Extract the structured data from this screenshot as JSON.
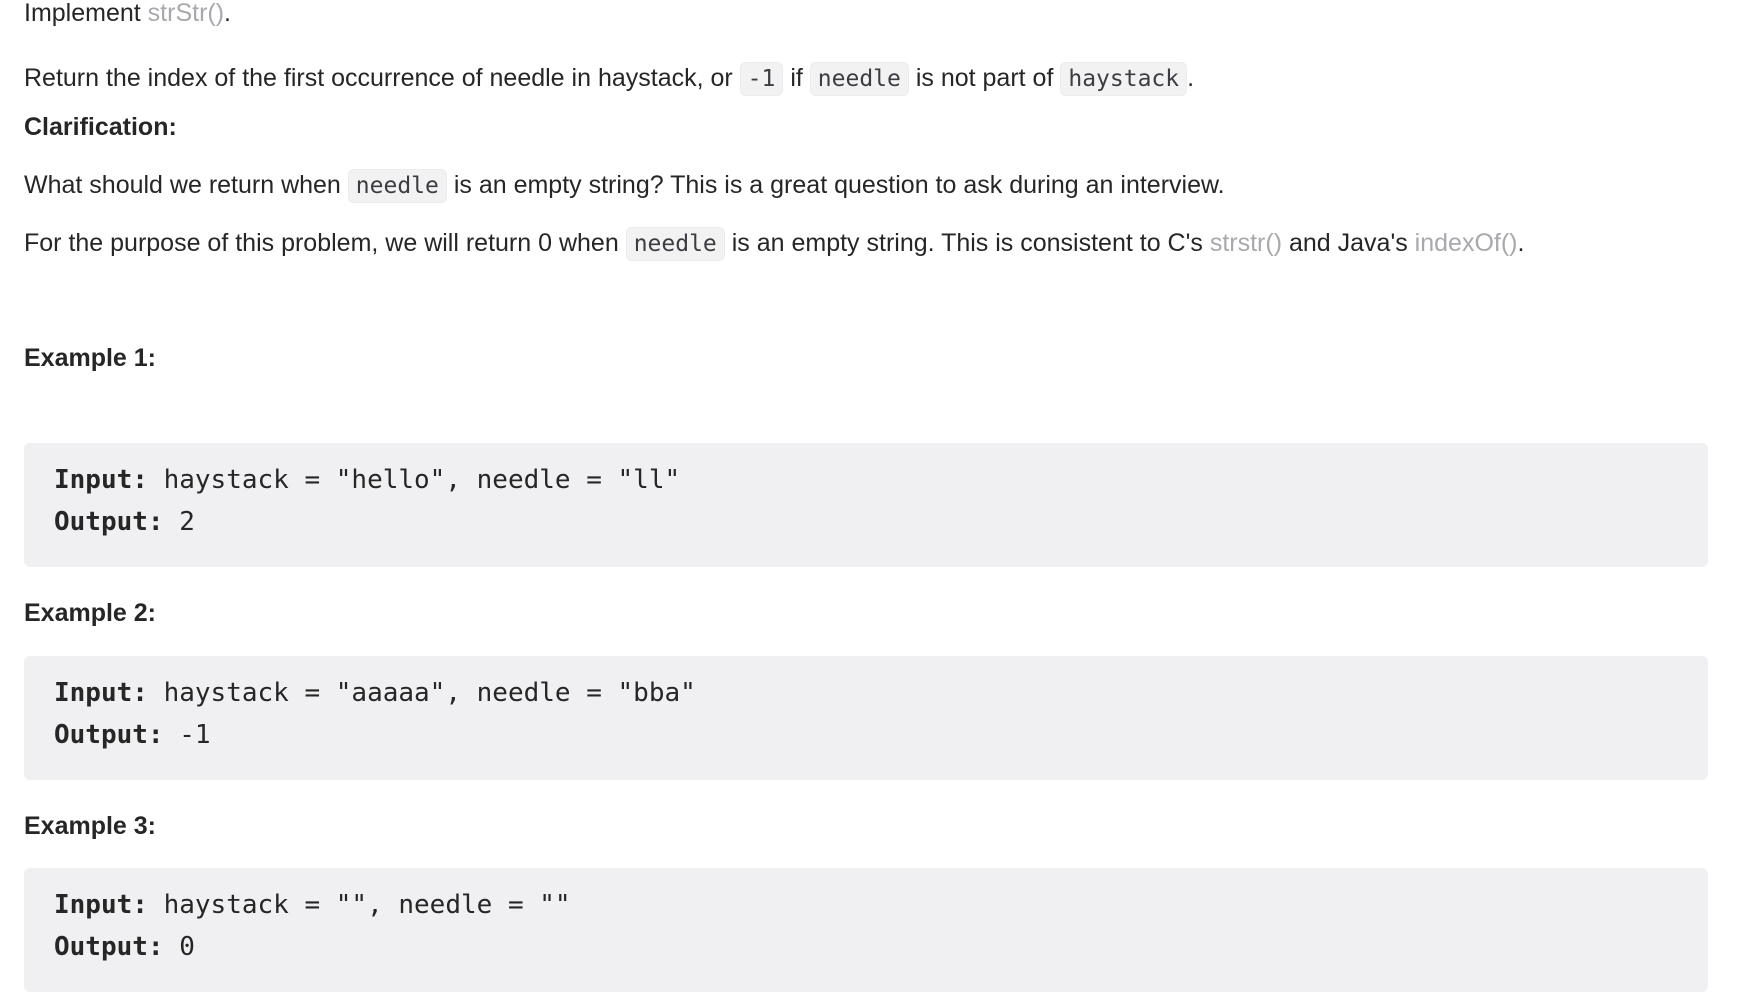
{
  "intro": {
    "implement_prefix": "Implement ",
    "implement_link": "strStr()",
    "implement_suffix": "."
  },
  "task": {
    "text1": "Return the index of the first occurrence of needle in haystack, or ",
    "code1": "-1",
    "text2": " if ",
    "code2": "needle",
    "text3": " is not part of ",
    "code3": "haystack",
    "text4": "."
  },
  "clarification": {
    "heading": "Clarification:",
    "question_prefix": "What should we return when ",
    "question_code": "needle",
    "question_suffix": " is an empty string? This is a great question to ask during an interview.",
    "answer_prefix": "For the purpose of this problem, we will return 0 when ",
    "answer_code": "needle",
    "answer_middle": " is an empty string. This is consistent to C's ",
    "answer_link1": "strstr()",
    "answer_and": " and Java's ",
    "answer_link2": "indexOf()",
    "answer_suffix": "."
  },
  "examples": [
    {
      "heading": "Example 1:",
      "input_label": "Input:",
      "input_value": " haystack = \"hello\", needle = \"ll\"",
      "output_label": "Output:",
      "output_value": " 2"
    },
    {
      "heading": "Example 2:",
      "input_label": "Input:",
      "input_value": " haystack = \"aaaaa\", needle = \"bba\"",
      "output_label": "Output:",
      "output_value": " -1"
    },
    {
      "heading": "Example 3:",
      "input_label": "Input:",
      "input_value": " haystack = \"\", needle = \"\"",
      "output_label": "Output:",
      "output_value": " 0"
    }
  ]
}
